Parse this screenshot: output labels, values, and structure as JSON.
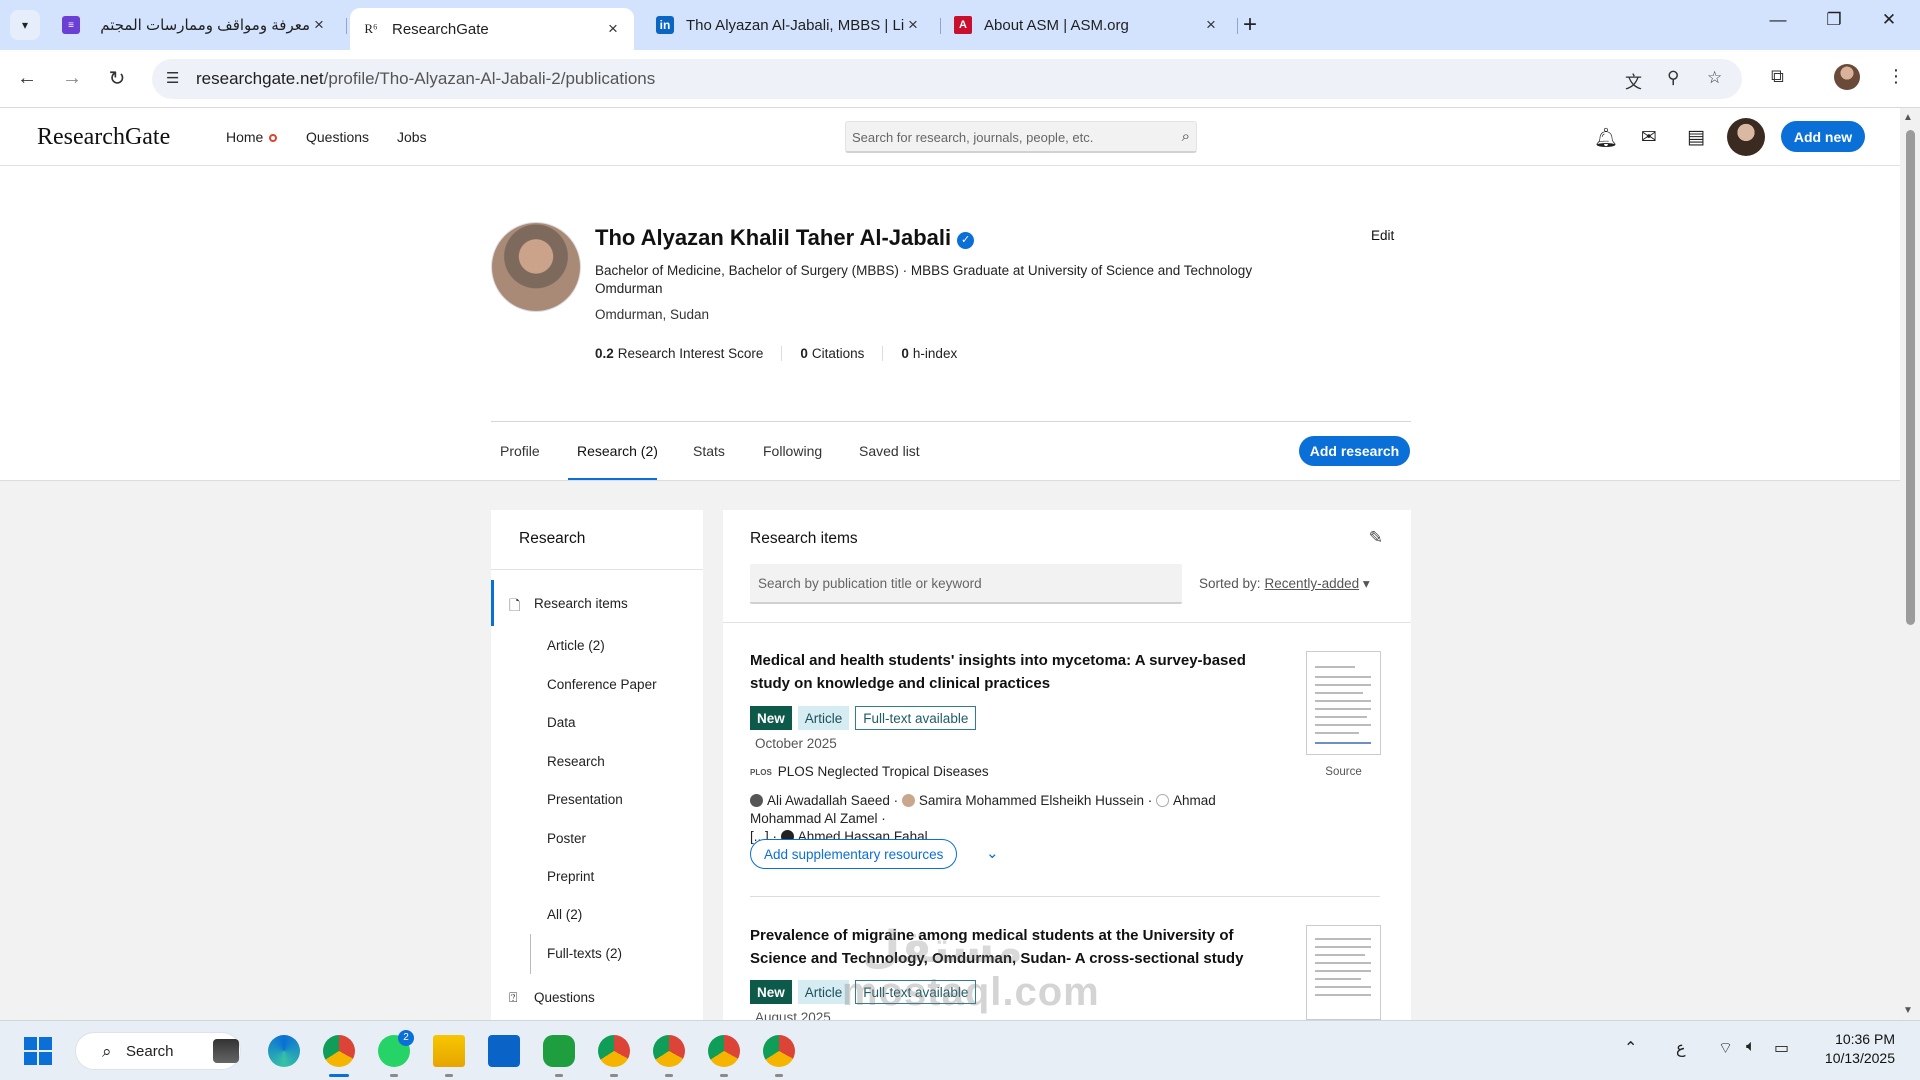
{
  "browser": {
    "tabs": [
      {
        "title": "معرفة ومواقف وممارسات المجتم",
        "favicon": "forms-icon",
        "color": "#6b3fd4"
      },
      {
        "title": "ResearchGate",
        "favicon": "R⁶",
        "color": "#222222"
      },
      {
        "title": "Tho Alyazan Al-Jabali, MBBS | Li",
        "favicon": "in",
        "color": "#0a66c2"
      },
      {
        "title": "About ASM | ASM.org",
        "favicon": "asm-icon",
        "color": "#c8102e"
      }
    ],
    "url_host": "researchgate.net",
    "url_path": "/profile/Tho-Alyazan-Al-Jabali-2/publications"
  },
  "rg_header": {
    "logo": "ResearchGate",
    "nav": [
      "Home",
      "Questions",
      "Jobs"
    ],
    "search_placeholder": "Search for research, journals, people, etc.",
    "add_new": "Add new"
  },
  "profile": {
    "name": "Tho Alyazan Khalil Taher Al-Jabali",
    "headline": "Bachelor of Medicine, Bachelor of Surgery (MBBS) · MBBS Graduate at University of Science and Technology Omdurman",
    "location": "Omdurman, Sudan",
    "stats": [
      {
        "value": "0.2",
        "label": "Research Interest Score"
      },
      {
        "value": "0",
        "label": "Citations"
      },
      {
        "value": "0",
        "label": "h-index"
      }
    ],
    "edit_label": "Edit",
    "tabs": [
      "Profile",
      "Research (2)",
      "Stats",
      "Following",
      "Saved list"
    ],
    "add_research": "Add research"
  },
  "sidebar": {
    "title": "Research",
    "active_item": "Research items",
    "items": [
      "Article (2)",
      "Conference Paper",
      "Data",
      "Research",
      "Presentation",
      "Poster",
      "Preprint",
      "All (2)",
      "Full-texts (2)"
    ],
    "questions": "Questions"
  },
  "research": {
    "title": "Research items",
    "search_placeholder": "Search by publication title or keyword",
    "sort_label": "Sorted by:",
    "sort_value": "Recently-added",
    "items": [
      {
        "title": "Medical and health students' insights into mycetoma: A survey-based study on knowledge and clinical practices",
        "badges": [
          "New",
          "Article",
          "Full-text available"
        ],
        "date": "October 2025",
        "journal_logo": "PLOS",
        "journal": "PLOS Neglected Tropical Diseases",
        "authors": [
          "Ali Awadallah Saeed",
          "Samira Mohammed Elsheikh Hussein",
          "Ahmad Mohammad Al Zamel",
          "[...]",
          "Ahmed Hassan Fahal"
        ],
        "supplementary": "Add supplementary resources",
        "source": "Source"
      },
      {
        "title": "Prevalence of migraine among medical students at the University of Science and Technology, Omdurman, Sudan- A cross-sectional study",
        "badges": [
          "New",
          "Article",
          "Full-text available"
        ],
        "date": "August 2025"
      }
    ]
  },
  "taskbar": {
    "search_label": "Search",
    "whatsapp_badge": "2",
    "lang": "ع",
    "time": "10:36 PM",
    "date": "10/13/2025"
  },
  "watermark": {
    "latin": "mostaql.com",
    "arabic": "مستقل"
  },
  "colors": {
    "accent": "#0a6fd6",
    "badge_new": "#0e5a4a",
    "badge_article": "#d4ecf2"
  }
}
